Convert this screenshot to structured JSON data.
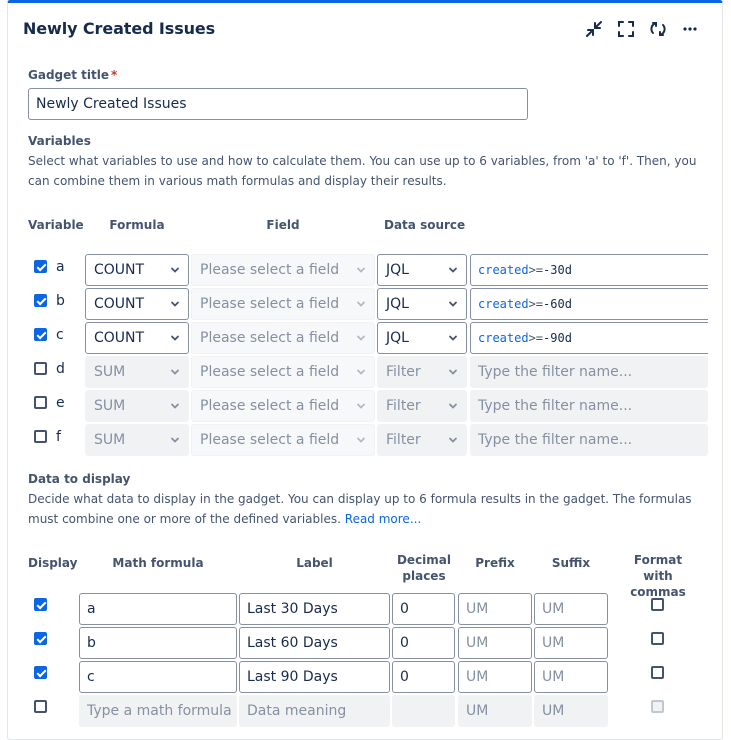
{
  "gadget": {
    "title": "Newly Created Issues"
  },
  "toolbar": {
    "icons": [
      "minimize-icon",
      "fullscreen-icon",
      "refresh-icon",
      "more-icon"
    ]
  },
  "gadget_title_field": {
    "label": "Gadget title",
    "required_mark": "*",
    "value": "Newly Created Issues"
  },
  "variables": {
    "heading": "Variables",
    "description": "Select what variables to use and how to calculate them. You can use up to 6 variables, from 'a' to 'f'. Then, you can combine them in various math formulas and display their results.",
    "columns": [
      "Variable",
      "Formula",
      "Field",
      "Data source"
    ],
    "rows": [
      {
        "checked": true,
        "letter": "a",
        "formula": "COUNT",
        "field_placeholder": "Please select a field",
        "source": "JQL",
        "query": {
          "kw": "created",
          "op": ">=",
          "val": "-30d"
        },
        "filter_placeholder": ""
      },
      {
        "checked": true,
        "letter": "b",
        "formula": "COUNT",
        "field_placeholder": "Please select a field",
        "source": "JQL",
        "query": {
          "kw": "created",
          "op": ">=",
          "val": "-60d"
        },
        "filter_placeholder": ""
      },
      {
        "checked": true,
        "letter": "c",
        "formula": "COUNT",
        "field_placeholder": "Please select a field",
        "source": "JQL",
        "query": {
          "kw": "created",
          "op": ">=",
          "val": "-90d"
        },
        "filter_placeholder": ""
      },
      {
        "checked": false,
        "letter": "d",
        "formula": "SUM",
        "field_placeholder": "Please select a field",
        "source": "Filter",
        "query": null,
        "filter_placeholder": "Type the filter name..."
      },
      {
        "checked": false,
        "letter": "e",
        "formula": "SUM",
        "field_placeholder": "Please select a field",
        "source": "Filter",
        "query": null,
        "filter_placeholder": "Type the filter name..."
      },
      {
        "checked": false,
        "letter": "f",
        "formula": "SUM",
        "field_placeholder": "Please select a field",
        "source": "Filter",
        "query": null,
        "filter_placeholder": "Type the filter name..."
      }
    ]
  },
  "display": {
    "heading": "Data to display",
    "description": "Decide what data to display in the gadget. You can display up to 6 formula results in the gadget. The formulas must combine one or more of the defined variables.",
    "read_more": "Read more...",
    "columns": {
      "display": "Display",
      "formula": "Math formula",
      "label": "Label",
      "decimal": "Decimal places",
      "prefix": "Prefix",
      "suffix": "Suffix",
      "commas": "Format with commas"
    },
    "rows": [
      {
        "checked": true,
        "formula": "a",
        "label": "Last 30 Days",
        "decimal": "0",
        "prefix": "UM",
        "suffix": "UM",
        "commas": false,
        "disabled": false
      },
      {
        "checked": true,
        "formula": "b",
        "label": "Last 60 Days",
        "decimal": "0",
        "prefix": "UM",
        "suffix": "UM",
        "commas": false,
        "disabled": false
      },
      {
        "checked": true,
        "formula": "c",
        "label": "Last 90 Days",
        "decimal": "0",
        "prefix": "UM",
        "suffix": "UM",
        "commas": false,
        "disabled": false
      },
      {
        "checked": false,
        "formula": "Type a math formula",
        "label": "Data meaning",
        "decimal": "",
        "prefix": "UM",
        "suffix": "UM",
        "commas": false,
        "disabled": true
      }
    ]
  }
}
